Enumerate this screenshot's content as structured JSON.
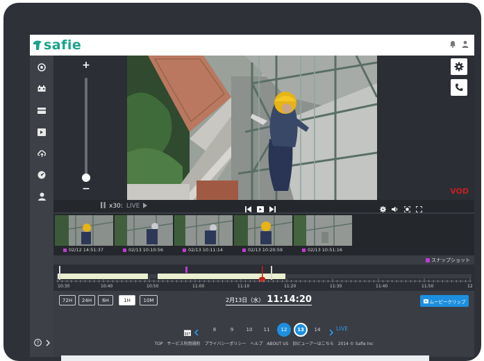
{
  "app": {
    "logo_text": "safie"
  },
  "controls": {
    "speed": "x30:",
    "live_label": "LIVE"
  },
  "vod_label": "VOD",
  "thumbnails": [
    {
      "timestamp": "02/12 14:51:37"
    },
    {
      "timestamp": "02/13 10:10:56"
    },
    {
      "timestamp": "02/13 10:11:14"
    },
    {
      "timestamp": "02/13 10:20:59"
    },
    {
      "timestamp": "02/13 10:51:16"
    }
  ],
  "snapshot_label": "スナップショット",
  "timeline": {
    "labels": [
      "10:30",
      "10:40",
      "10:50",
      "11:00",
      "11:10",
      "11:20",
      "11:30",
      "11:40",
      "11:50",
      "12"
    ]
  },
  "ranges": [
    {
      "label": "72H",
      "active": false
    },
    {
      "label": "24H",
      "active": false
    },
    {
      "label": "6H",
      "active": false
    },
    {
      "label": "1H",
      "active": true
    },
    {
      "label": "10M",
      "active": false
    }
  ],
  "datetime": {
    "date": "2月13日（水）",
    "time": "11:14:20"
  },
  "movie_clip_label": "ムービークリップ",
  "days": [
    {
      "label": "8",
      "state": ""
    },
    {
      "label": "9",
      "state": ""
    },
    {
      "label": "10",
      "state": ""
    },
    {
      "label": "11",
      "state": ""
    },
    {
      "label": "12",
      "state": "sel"
    },
    {
      "label": "13",
      "state": "cur"
    },
    {
      "label": "14",
      "state": ""
    }
  ],
  "live_link": "LIVE",
  "footer": "TOP　サービス利用規約　プライバシーポリシー　ヘルプ　ABOUT US　旧ビューアーはこちら　2014 © Safie Inc",
  "colors": {
    "brand": "#1aa38c",
    "accent": "#1d8fde",
    "snapshot": "#c03bd6",
    "vod": "#c4201f"
  }
}
